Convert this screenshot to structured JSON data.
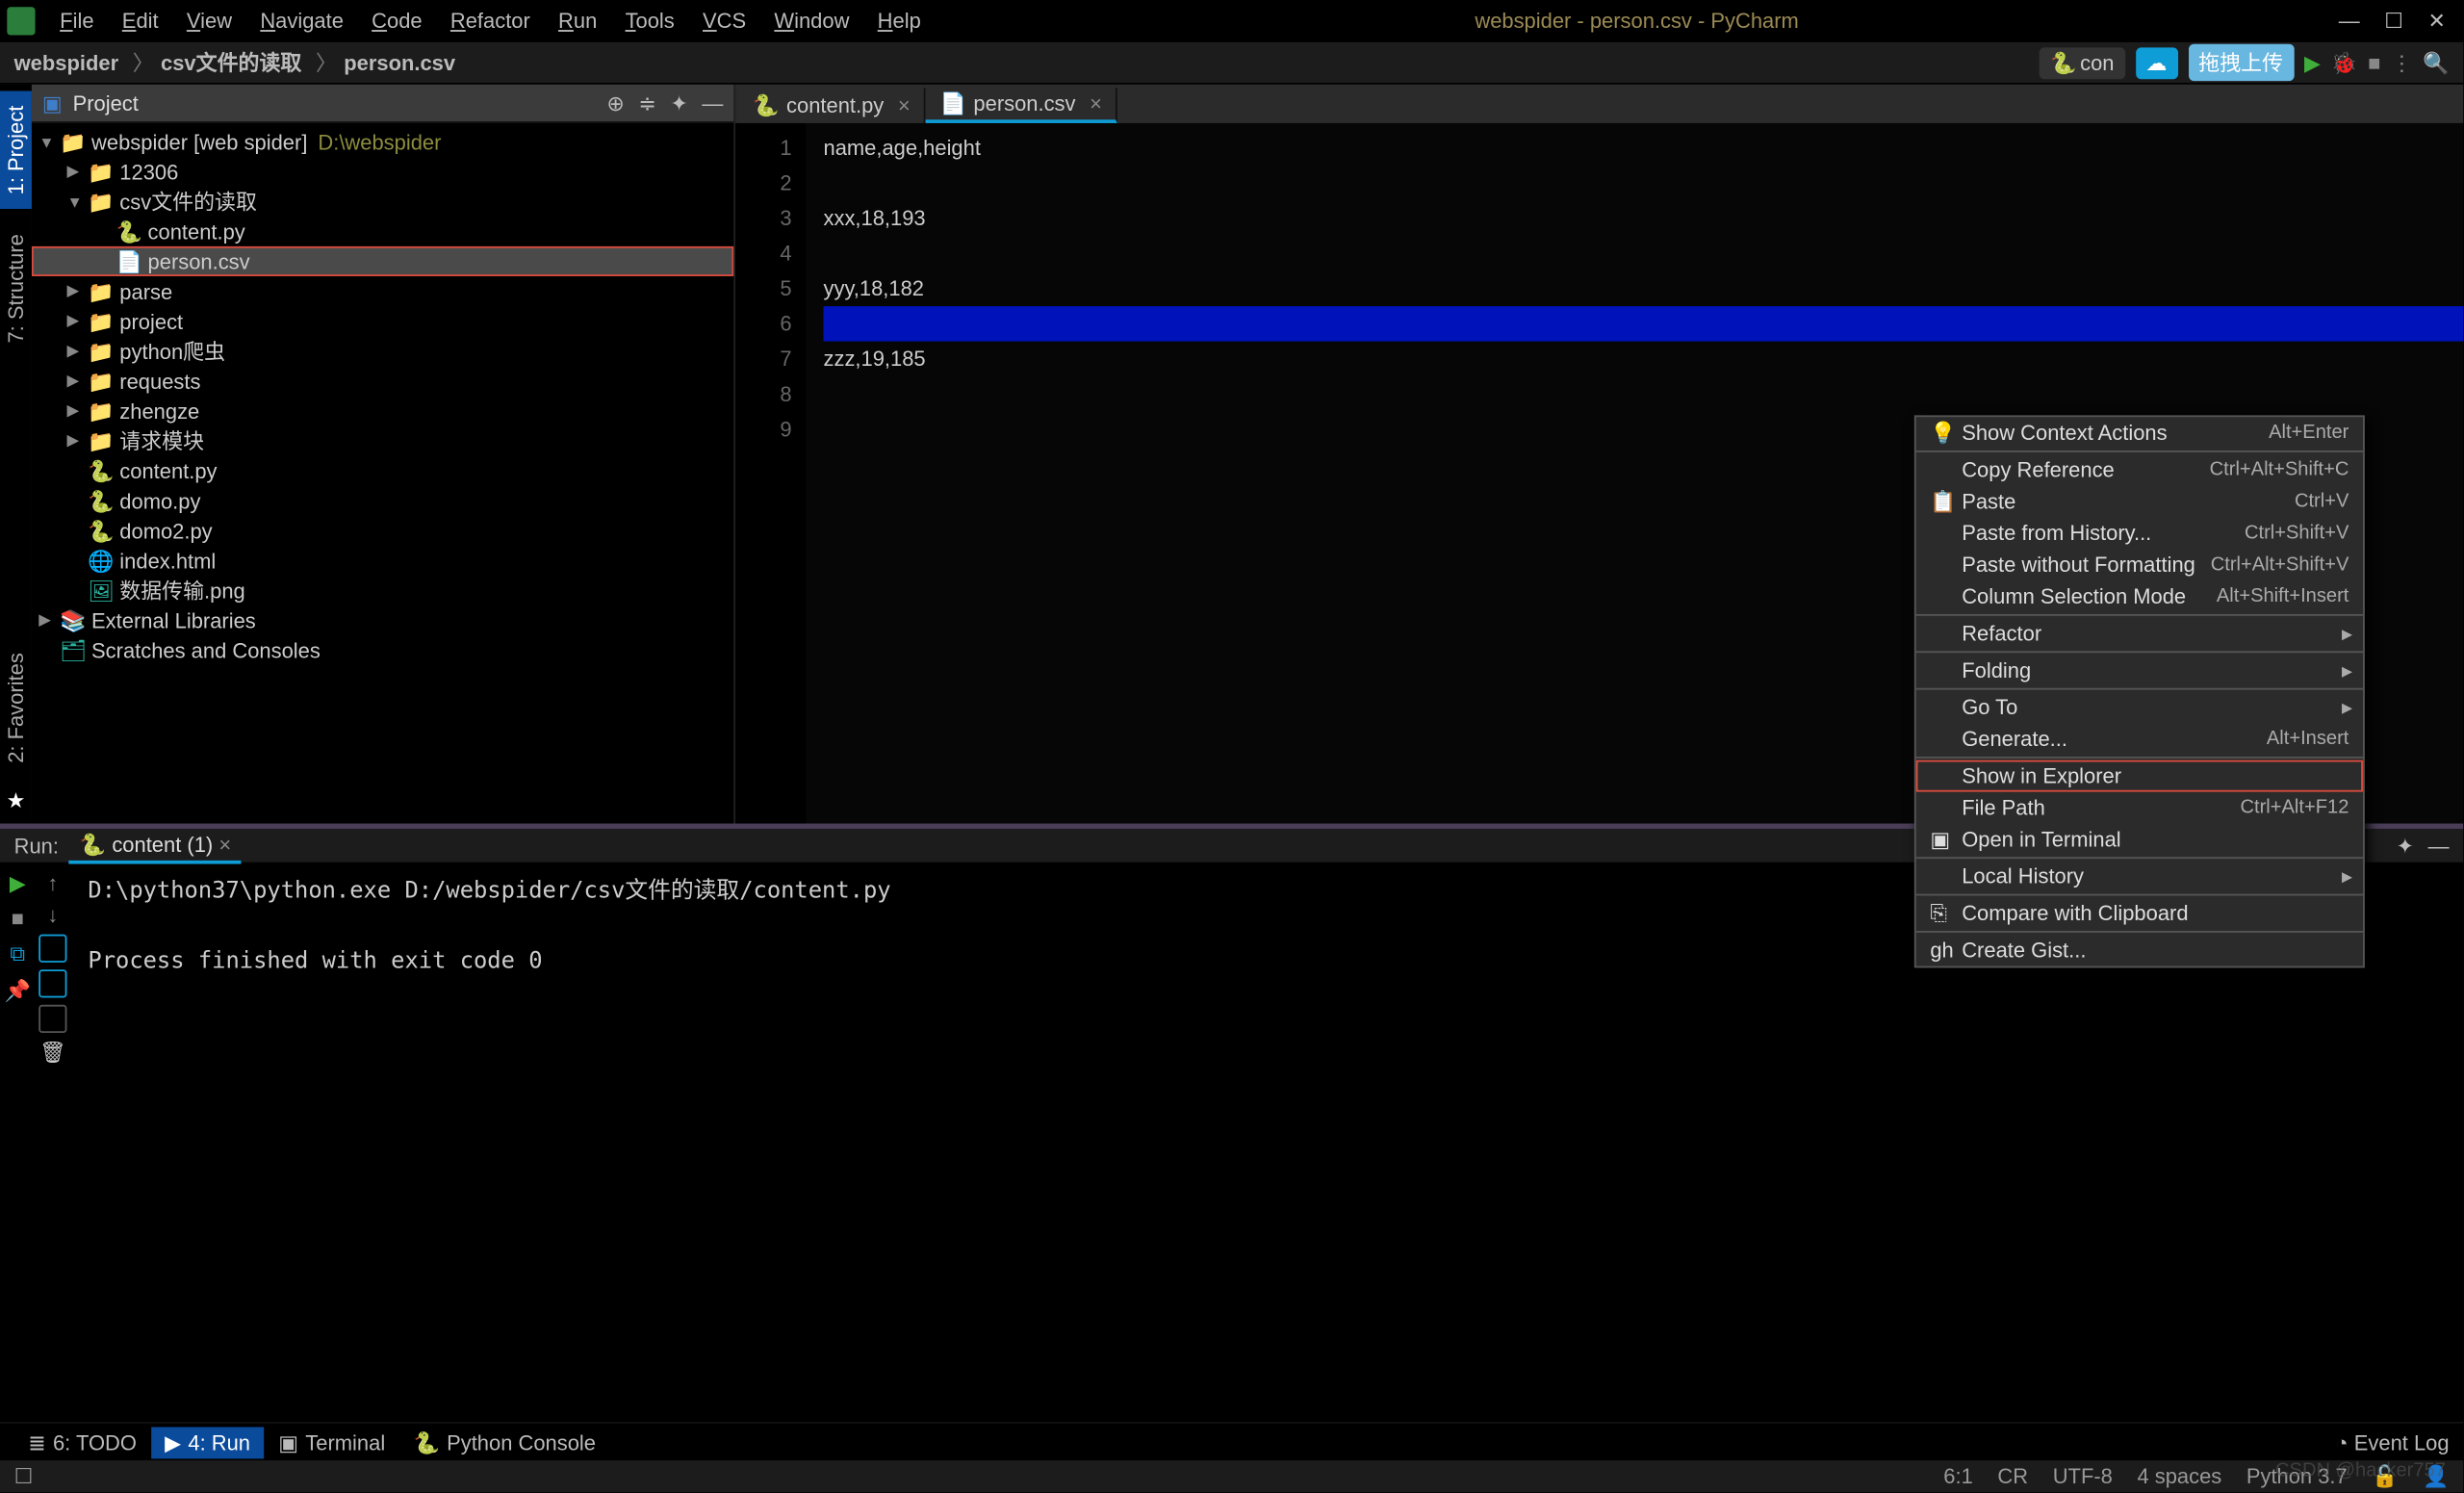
{
  "window_title": "webspider - person.csv - PyCharm",
  "menubar": [
    "File",
    "Edit",
    "View",
    "Navigate",
    "Code",
    "Refactor",
    "Run",
    "Tools",
    "VCS",
    "Window",
    "Help"
  ],
  "breadcrumbs": [
    "webspider",
    "csv文件的读取",
    "person.csv"
  ],
  "topbar": {
    "config_label": "con",
    "cloud_label": "☁",
    "upload_label": "拖拽上传"
  },
  "sidebar_tabs": [
    "1: Project",
    "7: Structure",
    "2: Favorites"
  ],
  "project_panel": {
    "title": "Project"
  },
  "tree": [
    {
      "depth": 0,
      "arrow": "▼",
      "icon": "📁",
      "label": "webspider [web spider]",
      "suffix": "D:\\webspider"
    },
    {
      "depth": 1,
      "arrow": "▶",
      "icon": "📁",
      "label": "12306"
    },
    {
      "depth": 1,
      "arrow": "▼",
      "icon": "📁",
      "label": "csv文件的读取"
    },
    {
      "depth": 2,
      "arrow": "",
      "icon": "py",
      "label": "content.py"
    },
    {
      "depth": 2,
      "arrow": "",
      "icon": "csv",
      "label": "person.csv",
      "selected": true,
      "highlight": true
    },
    {
      "depth": 1,
      "arrow": "▶",
      "icon": "📁",
      "label": "parse"
    },
    {
      "depth": 1,
      "arrow": "▶",
      "icon": "📁",
      "label": "project"
    },
    {
      "depth": 1,
      "arrow": "▶",
      "icon": "📁",
      "label": "python爬虫"
    },
    {
      "depth": 1,
      "arrow": "▶",
      "icon": "📁",
      "label": "requests"
    },
    {
      "depth": 1,
      "arrow": "▶",
      "icon": "📁",
      "label": "zhengze"
    },
    {
      "depth": 1,
      "arrow": "▶",
      "icon": "📁",
      "label": "请求模块"
    },
    {
      "depth": 1,
      "arrow": "",
      "icon": "py",
      "label": "content.py"
    },
    {
      "depth": 1,
      "arrow": "",
      "icon": "py",
      "label": "domo.py"
    },
    {
      "depth": 1,
      "arrow": "",
      "icon": "py",
      "label": "domo2.py"
    },
    {
      "depth": 1,
      "arrow": "",
      "icon": "html",
      "label": "index.html"
    },
    {
      "depth": 1,
      "arrow": "",
      "icon": "img",
      "label": "数据传输.png"
    },
    {
      "depth": 0,
      "arrow": "▶",
      "icon": "lib",
      "label": "External Libraries"
    },
    {
      "depth": 0,
      "arrow": "",
      "icon": "scr",
      "label": "Scratches and Consoles"
    }
  ],
  "editor_tabs": [
    {
      "label": "content.py",
      "active": false
    },
    {
      "label": "person.csv",
      "active": true
    }
  ],
  "code_lines": [
    "name,age,height",
    "",
    "xxx,18,193",
    "",
    "yyy,18,182",
    "",
    "zzz,19,185",
    "",
    ""
  ],
  "cursor_line_index": 5,
  "context_menu": [
    {
      "icon": "💡",
      "label": "Show Context Actions",
      "shortcut": "Alt+Enter"
    },
    {
      "sep": true
    },
    {
      "label": "Copy Reference",
      "shortcut": "Ctrl+Alt+Shift+C"
    },
    {
      "icon": "📋",
      "label": "Paste",
      "shortcut": "Ctrl+V"
    },
    {
      "label": "Paste from History...",
      "shortcut": "Ctrl+Shift+V"
    },
    {
      "label": "Paste without Formatting",
      "shortcut": "Ctrl+Alt+Shift+V"
    },
    {
      "label": "Column Selection Mode",
      "shortcut": "Alt+Shift+Insert"
    },
    {
      "sep": true
    },
    {
      "label": "Refactor",
      "submenu": true
    },
    {
      "sep": true
    },
    {
      "label": "Folding",
      "submenu": true
    },
    {
      "sep": true
    },
    {
      "label": "Go To",
      "submenu": true
    },
    {
      "label": "Generate...",
      "shortcut": "Alt+Insert"
    },
    {
      "sep": true
    },
    {
      "label": "Show in Explorer",
      "highlight": true
    },
    {
      "label": "File Path",
      "shortcut": "Ctrl+Alt+F12"
    },
    {
      "icon": "▣",
      "label": "Open in Terminal"
    },
    {
      "sep": true
    },
    {
      "label": "Local History",
      "submenu": true
    },
    {
      "sep": true
    },
    {
      "icon": "⎘",
      "label": "Compare with Clipboard"
    },
    {
      "sep": true
    },
    {
      "icon": "gh",
      "label": "Create Gist..."
    }
  ],
  "run": {
    "label": "Run:",
    "tab": "content (1)",
    "output": "D:\\python37\\python.exe D:/webspider/csv文件的读取/content.py\n\nProcess finished with exit code 0"
  },
  "bottom_tabs": [
    {
      "icon": "≣",
      "label": "6: TODO"
    },
    {
      "icon": "▶",
      "label": "4: Run",
      "active": true
    },
    {
      "icon": "▣",
      "label": "Terminal"
    },
    {
      "icon": "py",
      "label": "Python Console"
    }
  ],
  "event_log": "Event Log",
  "status": {
    "pos": "6:1",
    "eol": "CR",
    "enc": "UTF-8",
    "indent": "4 spaces",
    "interp": "Python 3.7"
  },
  "watermark": "CSDN @hacker757"
}
